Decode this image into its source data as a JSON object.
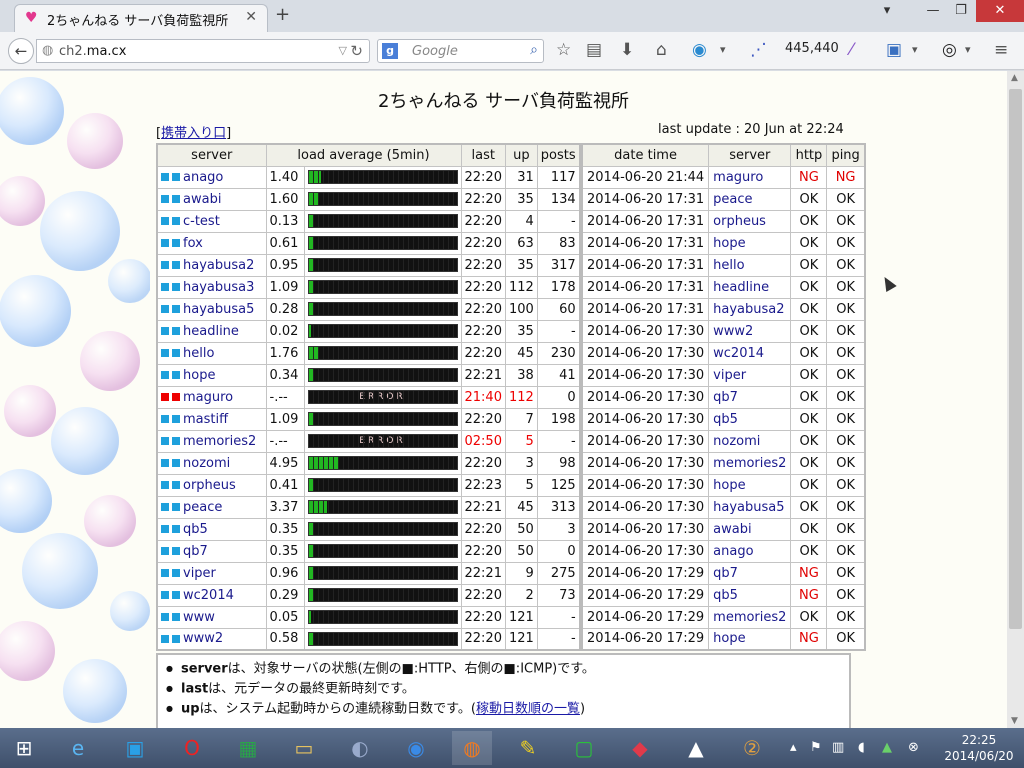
{
  "browser": {
    "tab_title": "2ちゃんねる サーバ負荷監視所",
    "new_tab": "+",
    "address_host": "ch2.",
    "address_domain": "ma.cx",
    "search_placeholder": "Google",
    "counter": "445,440",
    "win_min": "▾",
    "win_minimize": "—",
    "win_restore": "❐",
    "win_close": "✕"
  },
  "page": {
    "title": "2ちゃんねる サーバ負荷監視所",
    "mobile_link": "携帯入り口",
    "mobile_bracket_open": "[",
    "mobile_bracket_close": "]",
    "last_update": "last update : 20 Jun at 22:24"
  },
  "server_table": {
    "headers": [
      "server",
      "load average (5min)",
      "last",
      "up",
      "posts"
    ],
    "rows": [
      {
        "name": "anago",
        "load": "1.40",
        "level": 0.08,
        "last": "22:20",
        "up": "31",
        "posts": "117",
        "status": "ok"
      },
      {
        "name": "awabi",
        "load": "1.60",
        "level": 0.07,
        "last": "22:20",
        "up": "35",
        "posts": "134",
        "status": "ok"
      },
      {
        "name": "c-test",
        "load": "0.13",
        "level": 0.03,
        "last": "22:20",
        "up": "4",
        "posts": "-",
        "status": "ok"
      },
      {
        "name": "fox",
        "load": "0.61",
        "level": 0.03,
        "last": "22:20",
        "up": "63",
        "posts": "83",
        "status": "ok"
      },
      {
        "name": "hayabusa2",
        "load": "0.95",
        "level": 0.03,
        "last": "22:20",
        "up": "35",
        "posts": "317",
        "status": "ok"
      },
      {
        "name": "hayabusa3",
        "load": "1.09",
        "level": 0.03,
        "last": "22:20",
        "up": "112",
        "posts": "178",
        "status": "ok"
      },
      {
        "name": "hayabusa5",
        "load": "0.28",
        "level": 0.03,
        "last": "22:20",
        "up": "100",
        "posts": "60",
        "status": "ok"
      },
      {
        "name": "headline",
        "load": "0.02",
        "level": 0.0,
        "last": "22:20",
        "up": "35",
        "posts": "-",
        "status": "ok"
      },
      {
        "name": "hello",
        "load": "1.76",
        "level": 0.07,
        "last": "22:20",
        "up": "45",
        "posts": "230",
        "status": "ok"
      },
      {
        "name": "hope",
        "load": "0.34",
        "level": 0.03,
        "last": "22:21",
        "up": "38",
        "posts": "41",
        "status": "ok"
      },
      {
        "name": "maguro",
        "load": "-.--",
        "level": 0,
        "last": "21:40",
        "up": "112",
        "posts": "0",
        "status": "error",
        "error_text": "ERROR"
      },
      {
        "name": "mastiff",
        "load": "1.09",
        "level": 0.03,
        "last": "22:20",
        "up": "7",
        "posts": "198",
        "status": "ok"
      },
      {
        "name": "memories2",
        "load": "-.--",
        "level": 0,
        "last": "02:50",
        "up": "5",
        "posts": "-",
        "status": "error2",
        "error_text": "ERROR"
      },
      {
        "name": "nozomi",
        "load": "4.95",
        "level": 0.2,
        "last": "22:20",
        "up": "3",
        "posts": "98",
        "status": "ok"
      },
      {
        "name": "orpheus",
        "load": "0.41",
        "level": 0.03,
        "last": "22:23",
        "up": "5",
        "posts": "125",
        "status": "ok"
      },
      {
        "name": "peace",
        "load": "3.37",
        "level": 0.12,
        "last": "22:21",
        "up": "45",
        "posts": "313",
        "status": "ok"
      },
      {
        "name": "qb5",
        "load": "0.35",
        "level": 0.03,
        "last": "22:20",
        "up": "50",
        "posts": "3",
        "status": "ok"
      },
      {
        "name": "qb7",
        "load": "0.35",
        "level": 0.03,
        "last": "22:20",
        "up": "50",
        "posts": "0",
        "status": "ok"
      },
      {
        "name": "viper",
        "load": "0.96",
        "level": 0.03,
        "last": "22:21",
        "up": "9",
        "posts": "275",
        "status": "ok"
      },
      {
        "name": "wc2014",
        "load": "0.29",
        "level": 0.03,
        "last": "22:20",
        "up": "2",
        "posts": "73",
        "status": "ok"
      },
      {
        "name": "www",
        "load": "0.05",
        "level": 0.0,
        "last": "22:20",
        "up": "121",
        "posts": "-",
        "status": "ok"
      },
      {
        "name": "www2",
        "load": "0.58",
        "level": 0.03,
        "last": "22:20",
        "up": "121",
        "posts": "-",
        "status": "ok"
      }
    ]
  },
  "log_table": {
    "headers": [
      "date time",
      "server",
      "http",
      "ping"
    ],
    "rows": [
      {
        "dt": "2014-06-20 21:44",
        "server": "maguro",
        "http": "NG",
        "ping": "NG"
      },
      {
        "dt": "2014-06-20 17:31",
        "server": "peace",
        "http": "OK",
        "ping": "OK"
      },
      {
        "dt": "2014-06-20 17:31",
        "server": "orpheus",
        "http": "OK",
        "ping": "OK"
      },
      {
        "dt": "2014-06-20 17:31",
        "server": "hope",
        "http": "OK",
        "ping": "OK"
      },
      {
        "dt": "2014-06-20 17:31",
        "server": "hello",
        "http": "OK",
        "ping": "OK"
      },
      {
        "dt": "2014-06-20 17:31",
        "server": "headline",
        "http": "OK",
        "ping": "OK"
      },
      {
        "dt": "2014-06-20 17:31",
        "server": "hayabusa2",
        "http": "OK",
        "ping": "OK"
      },
      {
        "dt": "2014-06-20 17:30",
        "server": "www2",
        "http": "OK",
        "ping": "OK"
      },
      {
        "dt": "2014-06-20 17:30",
        "server": "wc2014",
        "http": "OK",
        "ping": "OK"
      },
      {
        "dt": "2014-06-20 17:30",
        "server": "viper",
        "http": "OK",
        "ping": "OK"
      },
      {
        "dt": "2014-06-20 17:30",
        "server": "qb7",
        "http": "OK",
        "ping": "OK"
      },
      {
        "dt": "2014-06-20 17:30",
        "server": "qb5",
        "http": "OK",
        "ping": "OK"
      },
      {
        "dt": "2014-06-20 17:30",
        "server": "nozomi",
        "http": "OK",
        "ping": "OK"
      },
      {
        "dt": "2014-06-20 17:30",
        "server": "memories2",
        "http": "OK",
        "ping": "OK"
      },
      {
        "dt": "2014-06-20 17:30",
        "server": "hope",
        "http": "OK",
        "ping": "OK"
      },
      {
        "dt": "2014-06-20 17:30",
        "server": "hayabusa5",
        "http": "OK",
        "ping": "OK"
      },
      {
        "dt": "2014-06-20 17:30",
        "server": "awabi",
        "http": "OK",
        "ping": "OK"
      },
      {
        "dt": "2014-06-20 17:30",
        "server": "anago",
        "http": "OK",
        "ping": "OK"
      },
      {
        "dt": "2014-06-20 17:29",
        "server": "qb7",
        "http": "NG",
        "ping": "OK"
      },
      {
        "dt": "2014-06-20 17:29",
        "server": "qb5",
        "http": "NG",
        "ping": "OK"
      },
      {
        "dt": "2014-06-20 17:29",
        "server": "memories2",
        "http": "OK",
        "ping": "OK"
      },
      {
        "dt": "2014-06-20 17:29",
        "server": "hope",
        "http": "NG",
        "ping": "OK"
      }
    ]
  },
  "notes": {
    "n1_key": "server",
    "n1_text": "は、対象サーバの状態(左側の■:HTTP、右側の■:ICMP)です。",
    "n2_key": "last",
    "n2_text": "は、元データの最終更新時刻です。",
    "n3_key": "up",
    "n3_text": "は、システム起動時からの連続稼動日数です。(",
    "n3_link": "稼動日数順の一覧",
    "n3_end": ")"
  },
  "taskbar": {
    "time": "22:25",
    "date": "2014/06/20"
  },
  "colors": {
    "ok_square": "#1ea0dc",
    "error_square": "#e00000",
    "ng_text": "#e00000",
    "bar_fill": "#22b822"
  }
}
